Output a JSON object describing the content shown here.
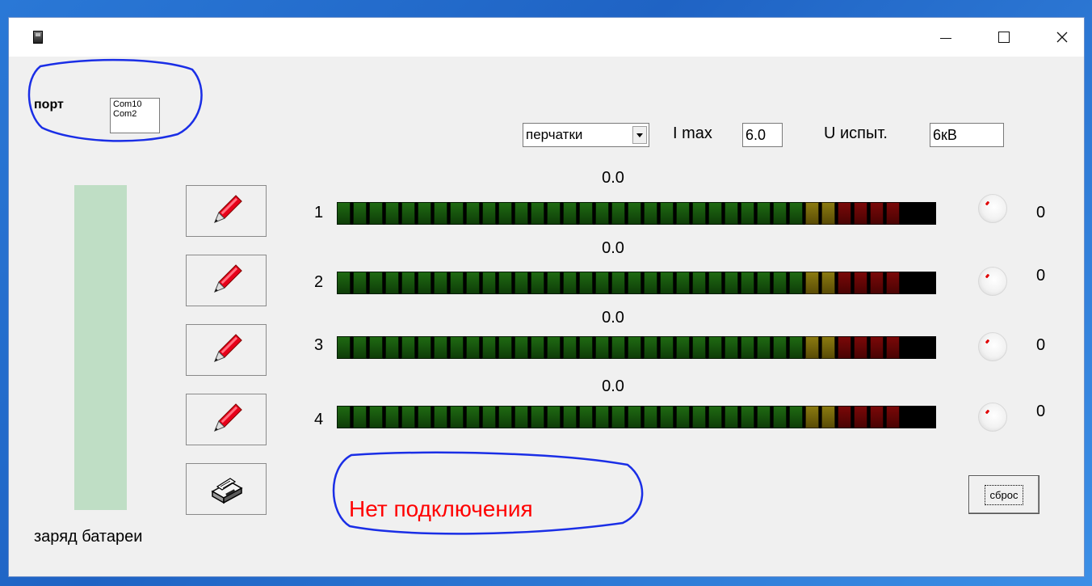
{
  "window": {
    "controls": {
      "minimize": "—",
      "maximize": "☐",
      "close": "✕"
    }
  },
  "port": {
    "label": "порт",
    "options": [
      "Com10",
      "Com2"
    ]
  },
  "settings": {
    "mode_selected": "перчатки",
    "imax_label": "I max",
    "imax_value": "6.0",
    "uisp_label": "U испыт.",
    "uisp_value": "6кВ"
  },
  "battery": {
    "label": "заряд батареи"
  },
  "channels": [
    {
      "num": "1",
      "value": "0.0",
      "count": "0"
    },
    {
      "num": "2",
      "value": "0.0",
      "count": "0"
    },
    {
      "num": "3",
      "value": "0.0",
      "count": "0"
    },
    {
      "num": "4",
      "value": "0.0",
      "count": "0"
    }
  ],
  "meter": {
    "green_segments": 29,
    "yellow_segments": 2,
    "red_segments": 4
  },
  "reset_label": "сброс",
  "status_text": "Нет подключения",
  "colors": {
    "status": "#ff0000",
    "annotation": "#1a2ee6",
    "battery_fill": "#bfdec5"
  }
}
